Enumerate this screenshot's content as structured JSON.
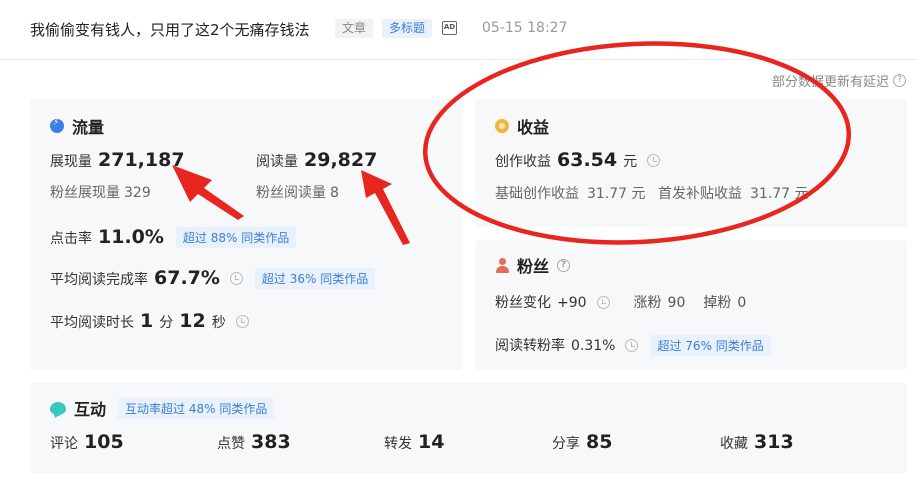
{
  "header": {
    "title": "我偷偷变有钱人，只用了这2个无痛存钱法",
    "tag_article": "文章",
    "tag_multi": "多标题",
    "ad_icon_text": "AD",
    "time": "05-15 18:27"
  },
  "note": "部分数据更新有延迟",
  "traffic": {
    "title": "流量",
    "impressions_label": "展现量",
    "impressions_value": "271,187",
    "fan_impressions_label": "粉丝展现量",
    "fan_impressions_value": "329",
    "reads_label": "阅读量",
    "reads_value": "29,827",
    "fan_reads_label": "粉丝阅读量",
    "fan_reads_value": "8",
    "ctr_label": "点击率",
    "ctr_value": "11.0%",
    "ctr_badge": "超过 88% 同类作品",
    "completion_label": "平均阅读完成率",
    "completion_value": "67.7%",
    "completion_badge": "超过 36% 同类作品",
    "duration_label": "平均阅读时长",
    "duration_min": "1",
    "duration_min_unit": "分",
    "duration_sec": "12",
    "duration_sec_unit": "秒"
  },
  "income": {
    "title": "收益",
    "creation_label": "创作收益",
    "creation_value": "63.54",
    "creation_unit": "元",
    "base_label": "基础创作收益",
    "base_value": "31.77 元",
    "subsidy_label": "首发补贴收益",
    "subsidy_value": "31.77 元"
  },
  "fans": {
    "title": "粉丝",
    "change_label": "粉丝变化",
    "change_value": "+90",
    "gain_label": "涨粉",
    "gain_value": "90",
    "loss_label": "掉粉",
    "loss_value": "0",
    "conversion_label": "阅读转粉率",
    "conversion_value": "0.31%",
    "conversion_badge": "超过 76% 同类作品"
  },
  "interaction": {
    "title": "互动",
    "badge": "互动率超过 48% 同类作品",
    "items": [
      {
        "label": "评论",
        "value": "105"
      },
      {
        "label": "点赞",
        "value": "383"
      },
      {
        "label": "转发",
        "value": "14"
      },
      {
        "label": "分享",
        "value": "85"
      },
      {
        "label": "收藏",
        "value": "313"
      }
    ]
  },
  "colors": {
    "accent_blue": "#3a7fd5",
    "annotation_red": "#e8251f",
    "card_bg": "#f7f8fa"
  }
}
